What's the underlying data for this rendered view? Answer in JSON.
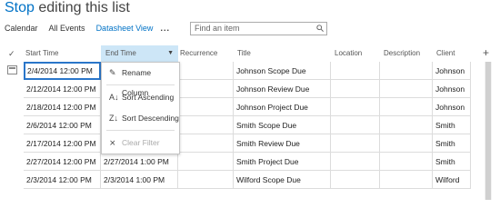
{
  "page": {
    "title_prefix": "Stop",
    "title_rest": " editing this list"
  },
  "views": {
    "calendar": "Calendar",
    "all_events": "All Events",
    "datasheet": "Datasheet View",
    "more": "..."
  },
  "search": {
    "placeholder": "Find an item"
  },
  "columns": {
    "check": "✓",
    "start": "Start Time",
    "end": "End Time",
    "recurrence": "Recurrence",
    "title": "Title",
    "location": "Location",
    "description": "Description",
    "client": "Client",
    "add": "+"
  },
  "rows": [
    {
      "start": "2/4/2014 12:00 PM",
      "end": "",
      "recurrence": "",
      "title": "Johnson Scope Due",
      "location": "",
      "description": "",
      "client": "Johnson"
    },
    {
      "start": "2/12/2014 12:00 PM",
      "end": "",
      "recurrence": "",
      "title": "Johnson Review Due",
      "location": "",
      "description": "",
      "client": "Johnson"
    },
    {
      "start": "2/18/2014 12:00 PM",
      "end": "",
      "recurrence": "",
      "title": "Johnson Project Due",
      "location": "",
      "description": "",
      "client": "Johnson"
    },
    {
      "start": "2/6/2014 12:00 PM",
      "end": "",
      "recurrence": "",
      "title": "Smith Scope Due",
      "location": "",
      "description": "",
      "client": "Smith"
    },
    {
      "start": "2/17/2014 12:00 PM",
      "end": "",
      "recurrence": "",
      "title": "Smith Review Due",
      "location": "",
      "description": "",
      "client": "Smith"
    },
    {
      "start": "2/27/2014 12:00 PM",
      "end": "2/27/2014 1:00 PM",
      "recurrence": "",
      "title": "Smith Project Due",
      "location": "",
      "description": "",
      "client": "Smith"
    },
    {
      "start": "2/3/2014 12:00 PM",
      "end": "2/3/2014 1:00 PM",
      "recurrence": "",
      "title": "Wilford Scope Due",
      "location": "",
      "description": "",
      "client": "Wilford"
    }
  ],
  "menu": {
    "rename": "Rename Column",
    "sort_asc": "Sort Ascending",
    "sort_desc": "Sort Descending",
    "clear_filter": "Clear Filter"
  },
  "colors": {
    "accent": "#0072c6",
    "header_selected": "#cde6f7",
    "selection_border": "#2a76c9"
  }
}
